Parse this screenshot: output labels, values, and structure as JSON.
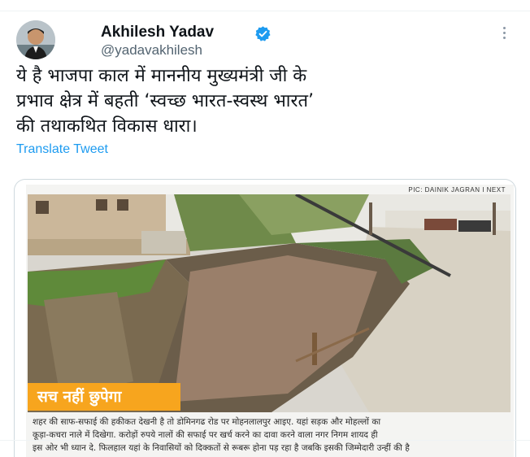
{
  "author": {
    "name": "Akhilesh Yadav",
    "handle": "@yadavakhilesh",
    "verified": true,
    "verified_color": "#1d9bf0"
  },
  "tweet": {
    "lines": [
      "ये है भाजपा काल में माननीय मुख्यमंत्री जी के",
      "प्रभाव क्षेत्र में बहती ‘स्वच्छ भारत-स्वस्थ भारत’",
      "की तथाकथित विकास धारा।"
    ]
  },
  "translate_label": "Translate Tweet",
  "media": {
    "credit": "PIC: DAINIK JAGRAN I NEXT",
    "banner": "सच नहीं छुपेगा",
    "banner_color": "#f7a51e",
    "caption_lines": [
      "शहर की साफ-सफाई की हकीकत देखनी है तो डोमिनगढ रोड पर मोहनलालपुर आइए. यहां सड़क और मोहल्लों का",
      "कूड़ा-कचरा नाले में दिखेगा. करोड़ों रुपये नालों की सफाई पर खर्च करने का दावा करने वाला नगर निगम शायद ही",
      "इस ओर भी ध्यान दे. फिलहाल यहां के निवासियों को दिक्कतों से रूबरू होना पड़ रहा है जबकि इसकी जिम्मेदारी उन्हीं की है"
    ]
  },
  "icons": {
    "more": "more-options-icon",
    "verified": "verified-badge-icon"
  }
}
